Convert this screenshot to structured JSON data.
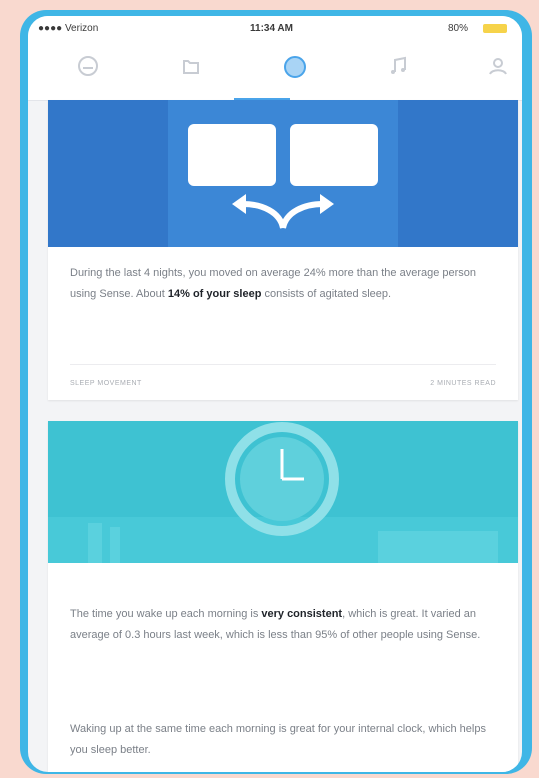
{
  "status_bar": {
    "carrier": "●●●● Verizon",
    "time": "11:34 AM",
    "battery": "80%"
  },
  "tabs": [
    {
      "name": "timeline",
      "icon": "sleep-face-icon"
    },
    {
      "name": "trends",
      "icon": "chart-icon"
    },
    {
      "name": "insights",
      "icon": "insights-icon",
      "active": true
    },
    {
      "name": "sounds",
      "icon": "music-note-icon"
    },
    {
      "name": "profile",
      "icon": "profile-icon"
    }
  ],
  "card1": {
    "text_pre": "During the last 4 nights, you moved on average 24% more than the average person using Sense. About ",
    "text_bold1": "14%",
    "text_bold2": "of your sleep",
    "text_post": " consists of agitated sleep.",
    "footer_left": "SLEEP MOVEMENT",
    "footer_right": "2 MINUTES READ"
  },
  "card2": {
    "p1_pre": "The time you wake up each morning is ",
    "p1_bold": "very consistent",
    "p1_post": ", which is great. It varied an average of 0.3 hours last week, which is less than 95% of other people using Sense.",
    "p2": "Waking up at the same time each morning is great for your internal clock, which helps you sleep better."
  },
  "colors": {
    "frame": "#3fb6e6",
    "card1_illustration": "#3277c9",
    "card2_illustration": "#3ec2d2",
    "active_tab": "#4aa4ea"
  }
}
